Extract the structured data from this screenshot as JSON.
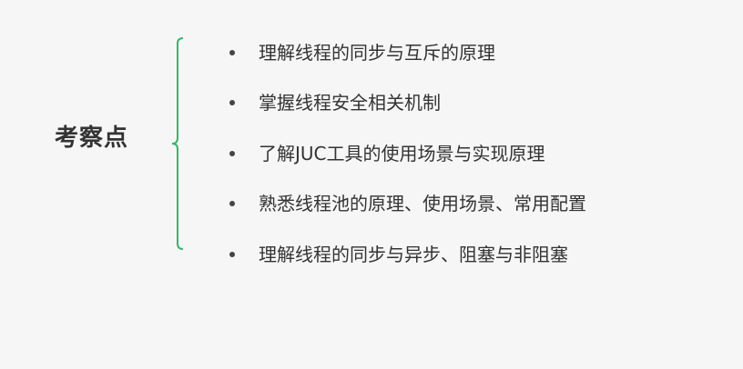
{
  "slide": {
    "heading": "考察点",
    "accent_color": "#3cb371",
    "items": [
      {
        "text": "理解线程的同步与互斥的原理"
      },
      {
        "text": "掌握线程安全相关机制"
      },
      {
        "text": "了解JUC工具的使用场景与实现原理"
      },
      {
        "text": "熟悉线程池的原理、使用场景、常用配置"
      },
      {
        "text": "理解线程的同步与异步、阻塞与非阻塞"
      }
    ]
  }
}
